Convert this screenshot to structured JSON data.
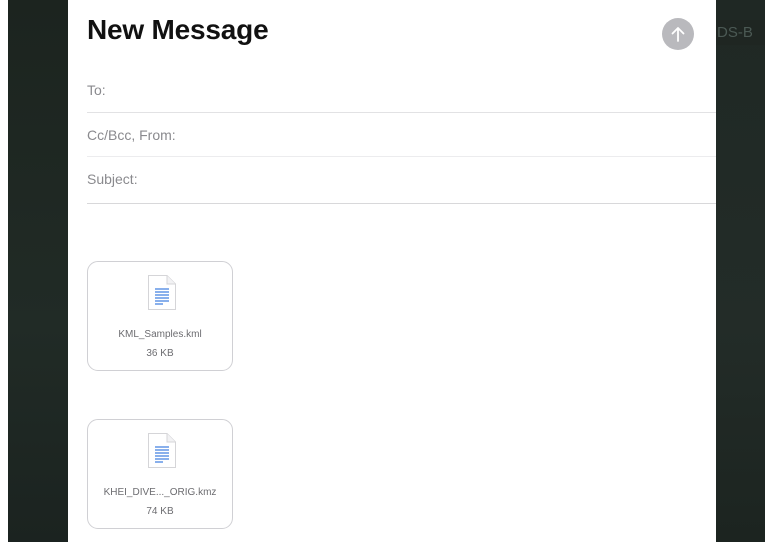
{
  "background": {
    "partial_label": "DS-B"
  },
  "compose": {
    "title": "New Message",
    "send_icon": "arrow-up-icon",
    "fields": {
      "to_label": "To:",
      "cc_from_label": "Cc/Bcc, From:",
      "subject_label": "Subject:"
    },
    "attachments": [
      {
        "name": "KML_Samples.kml",
        "size": "36 KB",
        "icon": "document-icon"
      },
      {
        "name": "KHEI_DIVE..._ORIG.kmz",
        "size": "74 KB",
        "icon": "document-icon"
      }
    ]
  },
  "colors": {
    "send_button": "#b9b9bd",
    "doc_lines": "#3a7be0",
    "backdrop": "#202a25"
  }
}
